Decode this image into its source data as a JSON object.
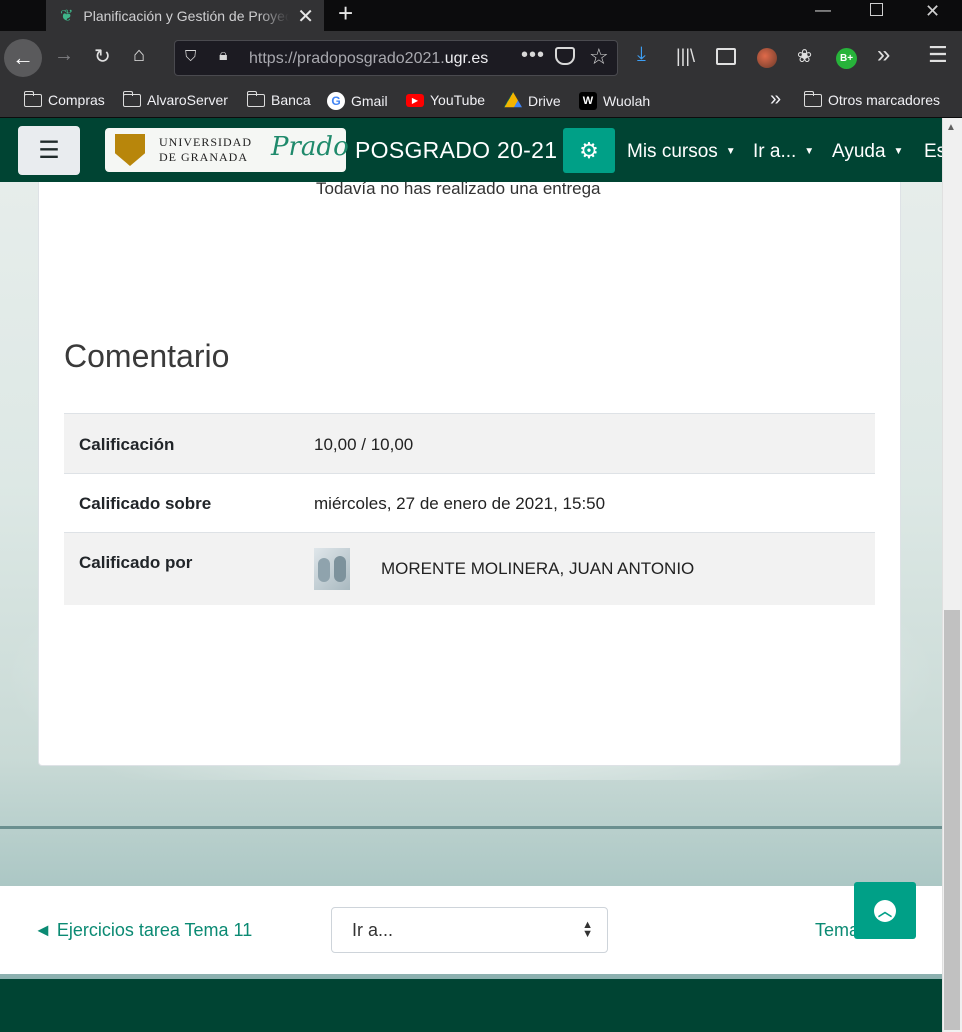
{
  "browser": {
    "tab_title": "Planificación y Gestión de Proyectos",
    "url_host": "pradoposgrado2021.",
    "url_domain": "ugr.es",
    "url_scheme": "https://",
    "bookmarks": [
      "Compras",
      "AlvaroServer",
      "Banca",
      "Gmail",
      "YouTube",
      "Drive",
      "Wuolah"
    ],
    "other_bookmarks": "Otros marcadores",
    "extension_badge": "B+"
  },
  "site": {
    "logo_text_line1": "UNIVERSIDAD",
    "logo_text_line2": "DE GRANADA",
    "logo_brand": "Prado",
    "name": "POSGRADO 20-21",
    "menu": [
      "Mis cursos",
      "Ir a...",
      "Ayuda",
      "Es"
    ]
  },
  "submission": {
    "status_text": "Todavía no has realizado una entrega"
  },
  "feedback": {
    "heading": "Comentario",
    "rows": [
      {
        "label": "Calificación",
        "value": "10,00 / 10,00"
      },
      {
        "label": "Calificado sobre",
        "value": "miércoles, 27 de enero de 2021, 15:50"
      },
      {
        "label": "Calificado por",
        "value": "MORENTE MOLINERA, JUAN ANTONIO"
      }
    ]
  },
  "activity_nav": {
    "prev_label": "◄ Ejercicios tarea Tema 11",
    "jump_label": "Ir a...",
    "next_label": "Tema"
  },
  "colors": {
    "brand_dark": "#004433",
    "accent": "#00a087",
    "link": "#0b8a73"
  }
}
